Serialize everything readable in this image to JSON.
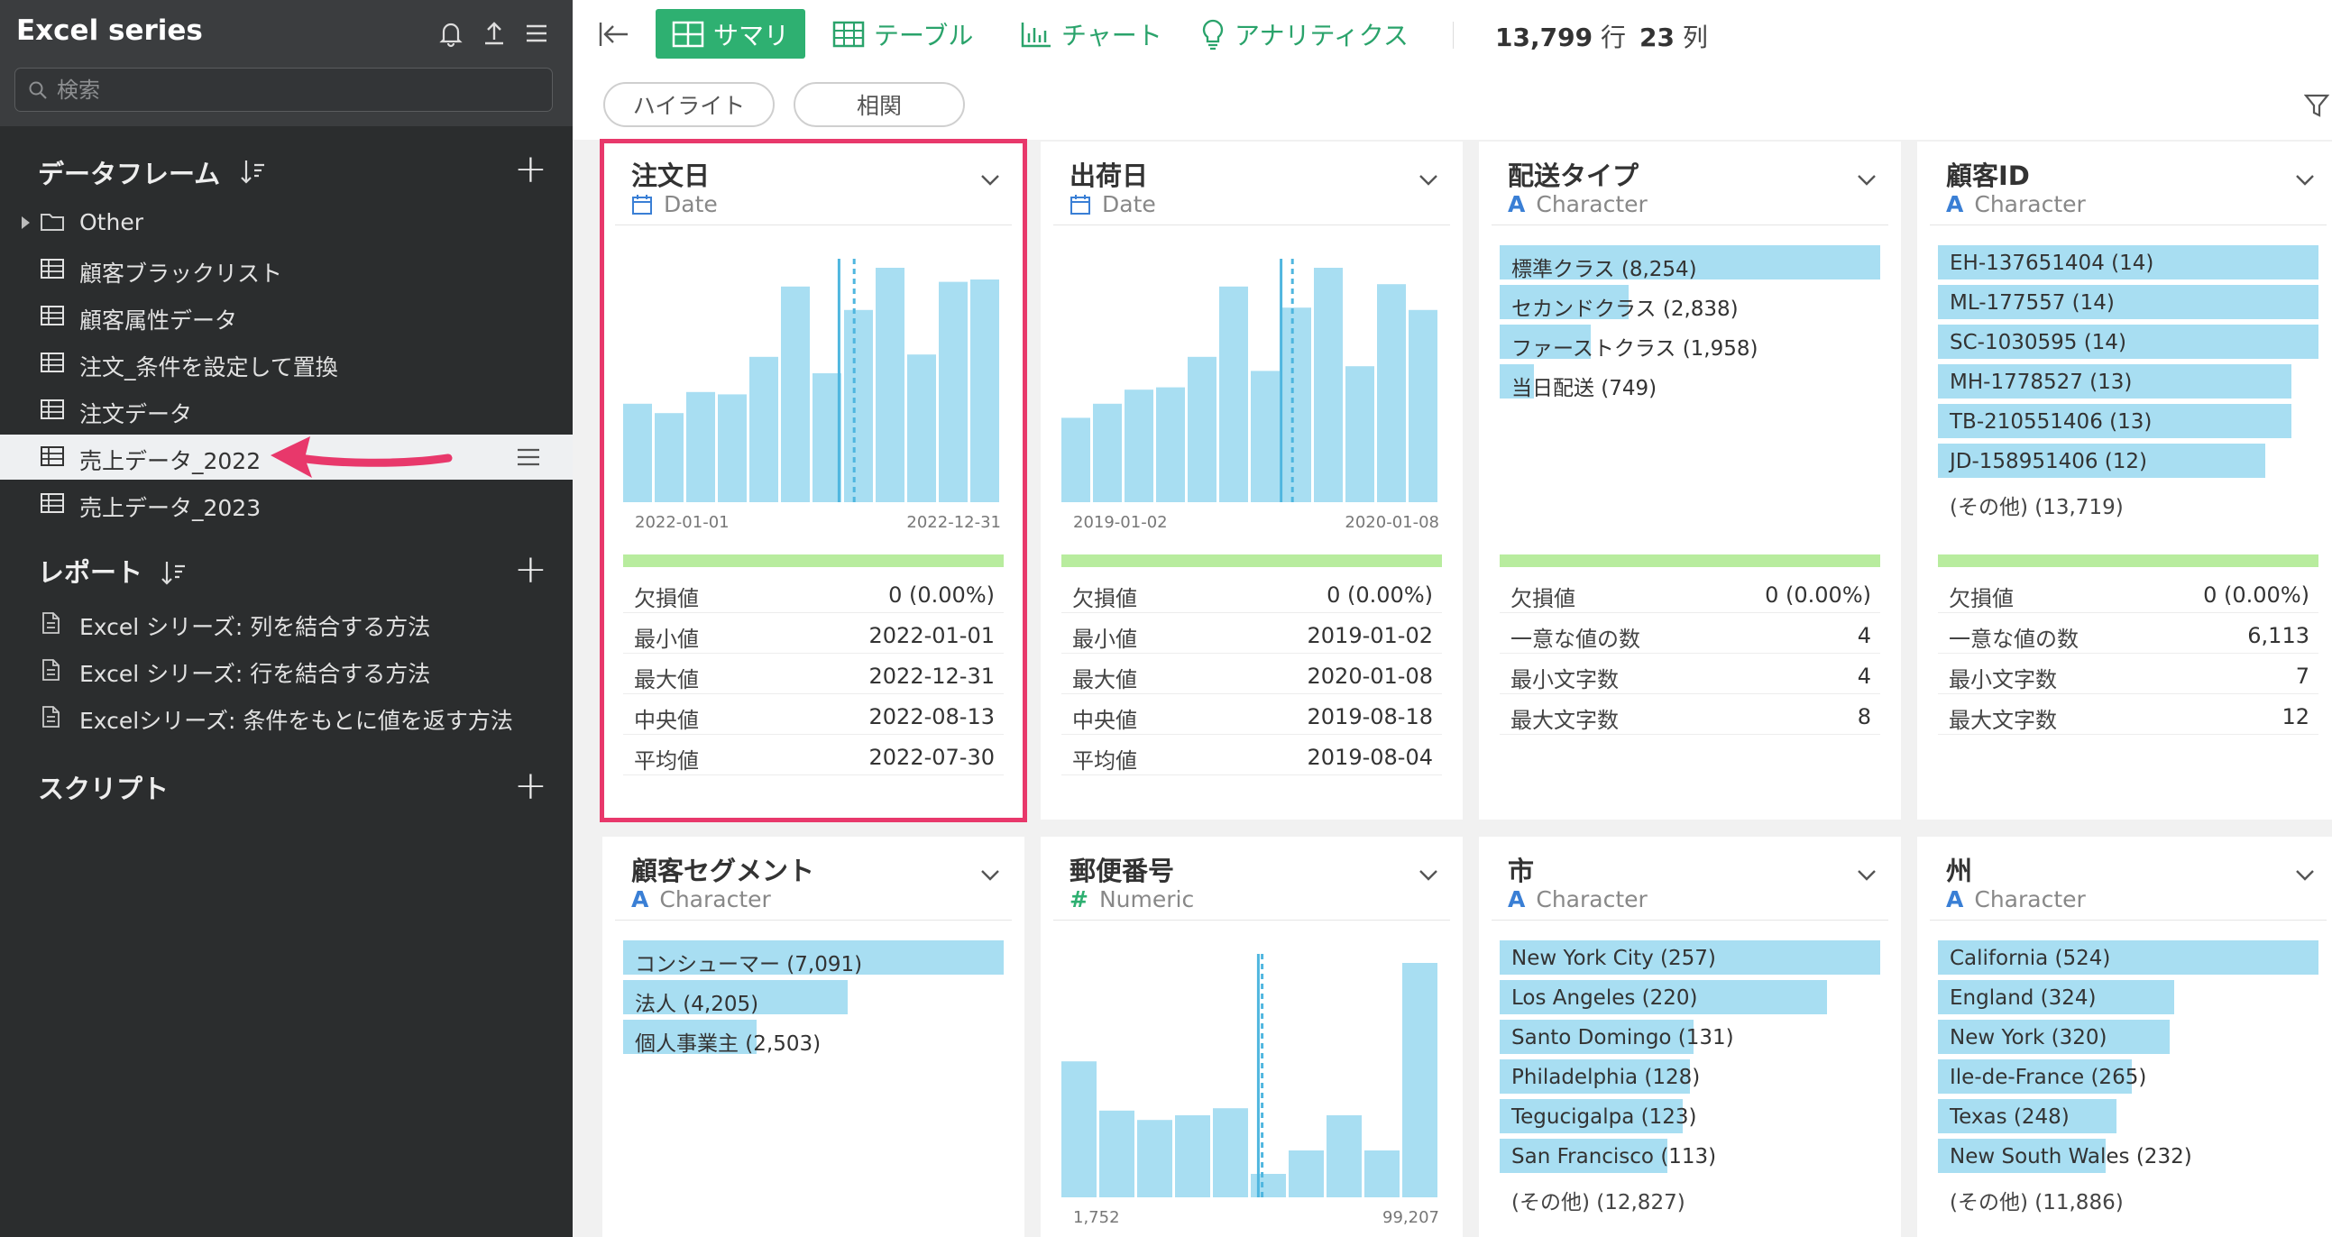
{
  "sidebar": {
    "app_title": "Excel series",
    "search_placeholder": "検索",
    "dataframes_header": "データフレーム",
    "folder_label": "Other",
    "dataframes": [
      "顧客ブラックリスト",
      "顧客属性データ",
      "注文_条件を設定して置換",
      "注文データ",
      "売上データ_2022",
      "売上データ_2023"
    ],
    "active_index": 4,
    "reports_header": "レポート",
    "reports": [
      "Excel シリーズ: 列を結合する方法",
      "Excel シリーズ: 行を結合する方法",
      "Excelシリーズ: 条件をもとに値を返す方法"
    ],
    "scripts_header": "スクリプト"
  },
  "toolbar": {
    "tabs": [
      "サマリ",
      "テーブル",
      "チャート",
      "アナリティクス"
    ],
    "row_count": "13,799",
    "row_unit": "行",
    "col_count": "23",
    "col_unit": "列"
  },
  "pills": [
    "ハイライト",
    "相関"
  ],
  "colors": {
    "accent": "#2eb071",
    "bar": "#a8def2",
    "highlight": "#e8386b",
    "green_bar": "#b8ec9e"
  },
  "cards": [
    {
      "title": "注文日",
      "type": "Date",
      "type_icon": "calendar-icon",
      "hist": [
        0.42,
        0.38,
        0.47,
        0.46,
        0.62,
        0.92,
        0.55,
        0.82,
        1.0,
        0.63,
        0.94,
        0.95
      ],
      "hist_median_frac": 0.61,
      "hist_mean_frac": 0.57,
      "axis_min": "2022-01-01",
      "axis_max": "2022-12-31",
      "stats": [
        [
          "欠損値",
          "0 (0.00%)"
        ],
        [
          "最小値",
          "2022-01-01"
        ],
        [
          "最大値",
          "2022-12-31"
        ],
        [
          "中央値",
          "2022-08-13"
        ],
        [
          "平均値",
          "2022-07-30"
        ]
      ]
    },
    {
      "title": "出荷日",
      "type": "Date",
      "type_icon": "calendar-icon",
      "hist": [
        0.36,
        0.42,
        0.48,
        0.49,
        0.62,
        0.92,
        0.56,
        0.83,
        1.0,
        0.58,
        0.93,
        0.82
      ],
      "hist_median_frac": 0.61,
      "hist_mean_frac": 0.58,
      "axis_min": "2019-01-02",
      "axis_max": "2020-01-08",
      "stats": [
        [
          "欠損値",
          "0 (0.00%)"
        ],
        [
          "最小値",
          "2019-01-02"
        ],
        [
          "最大値",
          "2020-01-08"
        ],
        [
          "中央値",
          "2019-08-18"
        ],
        [
          "平均値",
          "2019-08-04"
        ]
      ]
    },
    {
      "title": "配送タイプ",
      "type": "Character",
      "type_icon": "text-a-icon",
      "cats": [
        [
          "標準クラス (8,254)",
          1.0
        ],
        [
          "セカンドクラス (2,838)",
          0.34
        ],
        [
          "ファーストクラス (1,958)",
          0.24
        ],
        [
          "当日配送 (749)",
          0.09
        ]
      ],
      "other": "",
      "stats": [
        [
          "欠損値",
          "0 (0.00%)"
        ],
        [
          "一意な値の数",
          "4"
        ],
        [
          "最小文字数",
          "4"
        ],
        [
          "最大文字数",
          "8"
        ]
      ]
    },
    {
      "title": "顧客ID",
      "type": "Character",
      "type_icon": "text-a-icon",
      "cats": [
        [
          "EH-137651404 (14)",
          1.0
        ],
        [
          "ML-177557 (14)",
          1.0
        ],
        [
          "SC-1030595 (14)",
          1.0
        ],
        [
          "MH-1778527 (13)",
          0.93
        ],
        [
          "TB-210551406 (13)",
          0.93
        ],
        [
          "JD-158951406 (12)",
          0.86
        ]
      ],
      "other": "(その他) (13,719)",
      "stats": [
        [
          "欠損値",
          "0 (0.00%)"
        ],
        [
          "一意な値の数",
          "6,113"
        ],
        [
          "最小文字数",
          "7"
        ],
        [
          "最大文字数",
          "12"
        ]
      ]
    },
    {
      "title": "顧客セグメント",
      "type": "Character",
      "type_icon": "text-a-icon",
      "cats": [
        [
          "コンシューマー (7,091)",
          1.0
        ],
        [
          "法人 (4,205)",
          0.59
        ],
        [
          "個人事業主 (2,503)",
          0.35
        ]
      ],
      "other": ""
    },
    {
      "title": "郵便番号",
      "type": "Numeric",
      "type_icon": "hash-icon",
      "hist": [
        0.58,
        0.37,
        0.33,
        0.35,
        0.38,
        0.1,
        0.2,
        0.35,
        0.2,
        1.0
      ],
      "hist_median_frac": 0.53,
      "hist_mean_frac": 0.52,
      "axis_min": "1,752",
      "axis_max": "99,207"
    },
    {
      "title": "市",
      "type": "Character",
      "type_icon": "text-a-icon",
      "cats": [
        [
          "New York City (257)",
          1.0
        ],
        [
          "Los Angeles (220)",
          0.86
        ],
        [
          "Santo Domingo (131)",
          0.51
        ],
        [
          "Philadelphia (128)",
          0.5
        ],
        [
          "Tegucigalpa (123)",
          0.48
        ],
        [
          "San Francisco (113)",
          0.44
        ]
      ],
      "other": "(その他) (12,827)"
    },
    {
      "title": "州",
      "type": "Character",
      "type_icon": "text-a-icon",
      "cats": [
        [
          "California (524)",
          1.0
        ],
        [
          "England (324)",
          0.62
        ],
        [
          "New York (320)",
          0.61
        ],
        [
          "Ile-de-France (265)",
          0.51
        ],
        [
          "Texas (248)",
          0.47
        ],
        [
          "New South Wales (232)",
          0.44
        ]
      ],
      "other": "(その他) (11,886)"
    }
  ]
}
